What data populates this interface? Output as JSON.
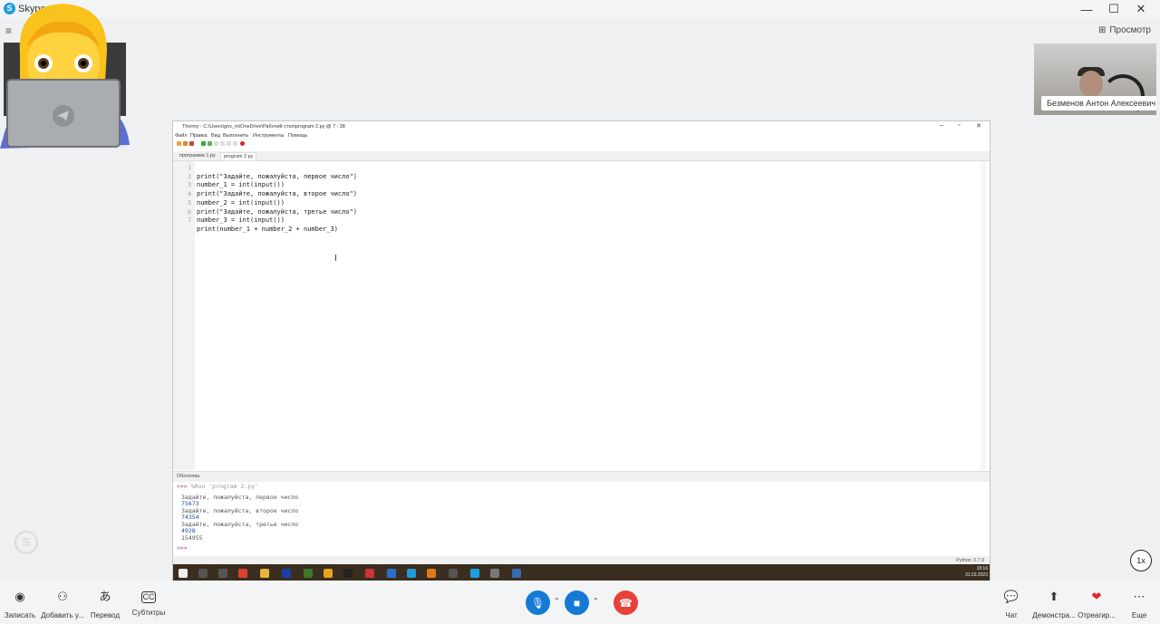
{
  "window": {
    "app_title": "Skype",
    "minimize": "—",
    "maximize": "☐",
    "close": "✕"
  },
  "header": {
    "menu_icon": "≡",
    "preview_label": "Просмотр"
  },
  "remote": {
    "name": "Безменов Антон Алексеевич"
  },
  "thonny": {
    "title": "Thonny  -  C:\\Users\\gnv_m\\OneDrive\\Рабочий стол\\program 2.py  @  7 : 38",
    "menu": [
      "Файл",
      "Правка",
      "Вид",
      "Выполнить",
      "Инструменты",
      "Помощь"
    ],
    "tabs": [
      "программа 1.py",
      "program 2.py"
    ],
    "line_numbers": [
      "1",
      "2",
      "3",
      "4",
      "5",
      "6",
      "7"
    ],
    "code": [
      "print(\"Задайте, пожалуйста, первое число\")",
      "number_1 = int(input())",
      "print(\"Задайте, пожалуйста, второе число\")",
      "number_2 = int(input())",
      "print(\"Задайте, пожалуйста, третье число\")",
      "number_3 = int(input())",
      "print(number_1 + number_2 + number_3)"
    ],
    "shell_tab": "Оболочка",
    "shell": {
      "prompt": ">>>",
      "run_cmd": "%Run 'program 2.py'",
      "lines": [
        {
          "kind": "out",
          "text": "Задайте, пожалуйста, первое число"
        },
        {
          "kind": "inp",
          "text": "75673"
        },
        {
          "kind": "out",
          "text": "Задайте, пожалуйста, второе число"
        },
        {
          "kind": "inp",
          "text": "74354"
        },
        {
          "kind": "out",
          "text": "Задайте, пожалуйста, третье число"
        },
        {
          "kind": "inp",
          "text": "4928"
        },
        {
          "kind": "out",
          "text": "154955"
        }
      ],
      "final_prompt": ">>>"
    },
    "status": "Python 3.7.9",
    "clock_time": "18:16",
    "clock_date": "31.03.2023"
  },
  "speed": "1x",
  "callbar": {
    "left": [
      {
        "label": "Записать",
        "icon": "record-icon"
      },
      {
        "label": "Добавить у...",
        "icon": "add-person-icon"
      },
      {
        "label": "Перевод",
        "icon": "translate-icon"
      },
      {
        "label": "Субтитры",
        "icon": "captions-icon"
      }
    ],
    "right": [
      {
        "label": "Чат",
        "icon": "chat-icon"
      },
      {
        "label": "Демонстра...",
        "icon": "share-screen-icon"
      },
      {
        "label": "Отреагир...",
        "icon": "react-heart-icon"
      },
      {
        "label": "Еще",
        "icon": "more-icon"
      }
    ]
  },
  "colors": {
    "mic": "#1679d4",
    "video": "#1679d4",
    "hangup": "#e8413a",
    "heart": "#e8262c"
  }
}
